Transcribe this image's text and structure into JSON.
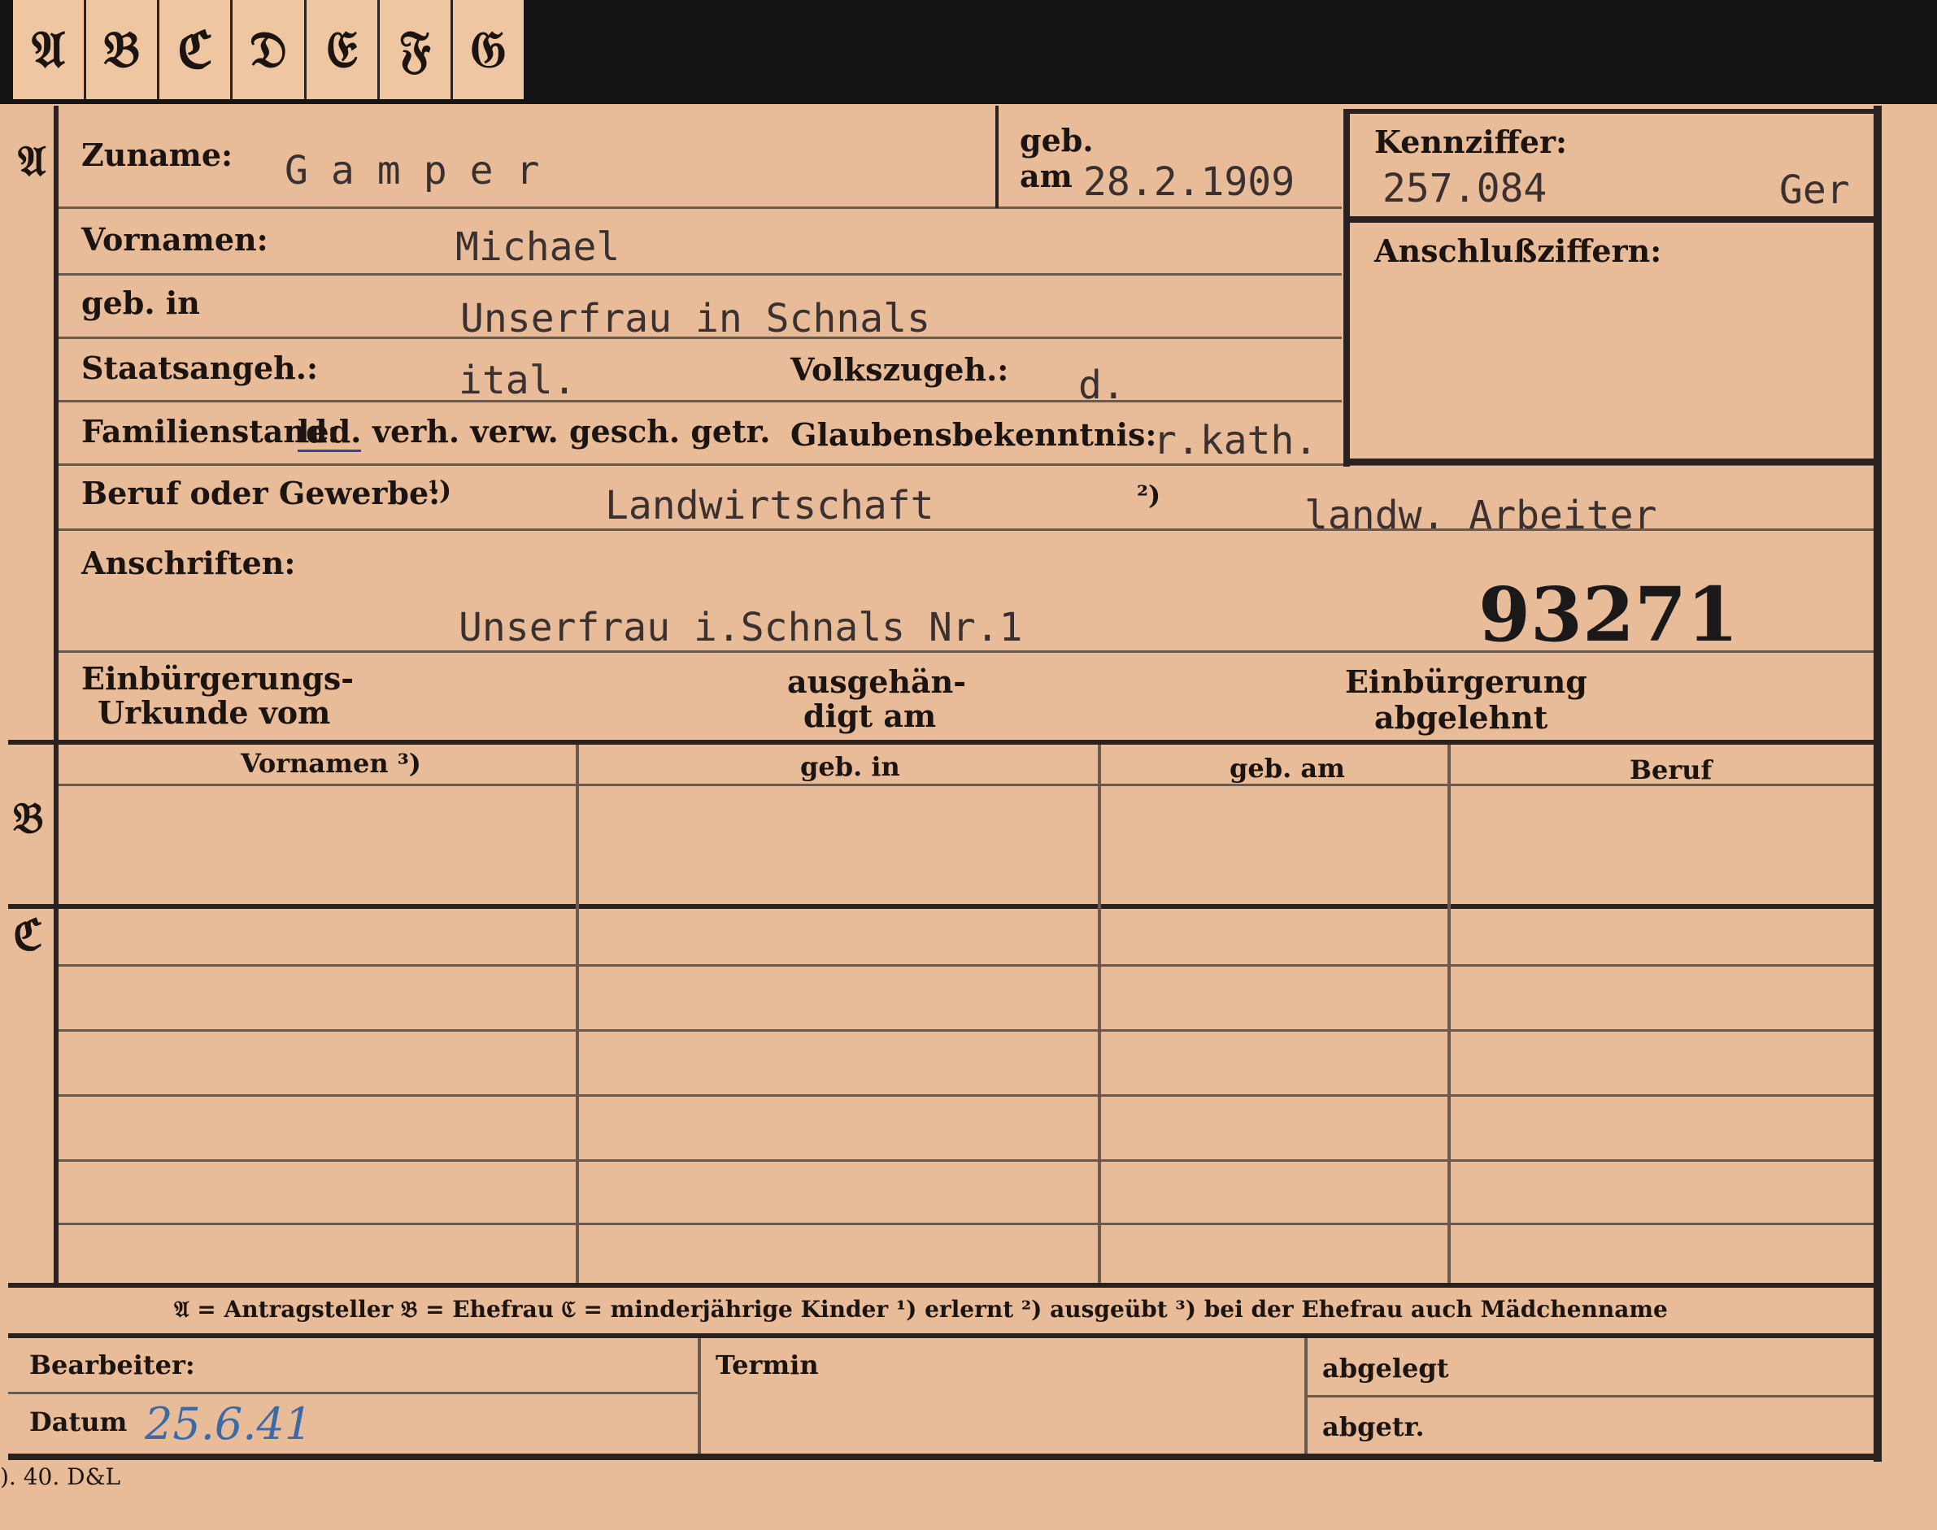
{
  "tabs": [
    "𝔄",
    "𝔅",
    "ℭ",
    "𝔇",
    "𝔈",
    "𝔉",
    "𝔊"
  ],
  "sections": {
    "a": "𝔄",
    "b": "𝔅",
    "c": "ℭ"
  },
  "a": {
    "zuname_label": "Zuname:",
    "zuname_value": "Gamper",
    "geb_label": "geb.",
    "am_label": "am",
    "geb_am_value": "28.2.1909",
    "kennziffer_label": "Kennziffer:",
    "kennziffer_value": "257.084",
    "kennziffer_suffix": "Ger",
    "anschluss_label": "Anschlußziffern:",
    "vornamen_label": "Vornamen:",
    "vornamen_value": "Michael",
    "geb_in_label": "geb. in",
    "geb_in_value": "Unserfrau in Schnals",
    "staats_label": "Staatsangeh.:",
    "staats_value": "ital.",
    "volks_label": "Volkszugeh.:",
    "volks_value": "d.",
    "familienstand_label": "Familienstand:",
    "familienstand_opt1": "led.",
    "familienstand_rest": "verh. verw. gesch. getr.",
    "glaube_label": "Glaubensbekenntnis:",
    "glaube_value": "r.kath.",
    "beruf_label": "Beruf oder Gewerbe:",
    "beruf_mark1": "¹)",
    "beruf_value1": "Landwirtschaft",
    "beruf_mark2": "²)",
    "beruf_value2": "landw. Arbeiter",
    "anschriften_label": "Anschriften:",
    "anschrift_value": "Unserfrau i.Schnals  Nr.1",
    "stamp_number": "93271",
    "einb_label1": "Einbürgerungs-",
    "einb_label2": "Urkunde vom",
    "ausg_label1": "ausgehän-",
    "ausg_label2": "digt am",
    "abgel_label1": "Einbürgerung",
    "abgel_label2": "abgelehnt"
  },
  "b": {
    "headers": [
      "Vornamen ³)",
      "geb. in",
      "geb. am",
      "Beruf"
    ]
  },
  "legend": "𝔄 = Antragsteller   𝔅 = Ehefrau   ℭ = minderjährige Kinder   ¹) erlernt   ²) ausgeübt   ³) bei der Ehefrau auch Mädchenname",
  "footer": {
    "bearbeiter_label": "Bearbeiter:",
    "termin_label": "Termin",
    "abgelegt_label": "abgelegt",
    "datum_label": "Datum",
    "datum_value": "25.6.41",
    "abgetr_label": "abgetr.",
    "print_code": "). 40. D&L"
  }
}
